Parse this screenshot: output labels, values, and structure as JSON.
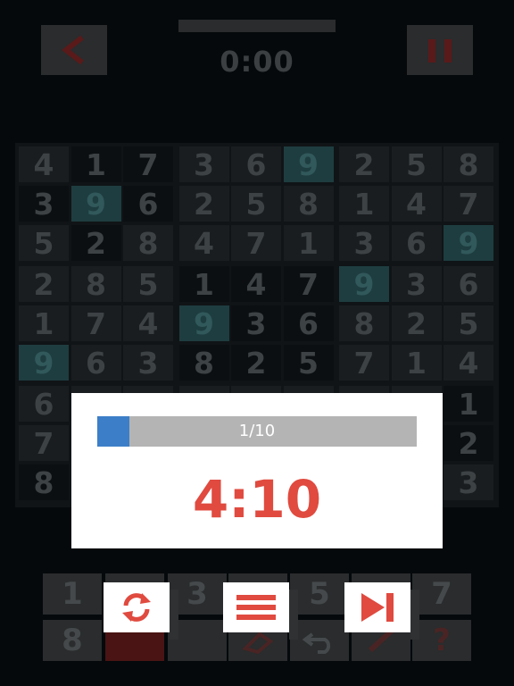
{
  "header": {
    "timer": "0:00",
    "back_icon": "chevron-left-icon",
    "pause_icon": "pause-icon"
  },
  "grid": {
    "rows": [
      [
        "4",
        "1",
        "7",
        "3",
        "6",
        "9",
        "2",
        "5",
        "8"
      ],
      [
        "3",
        "9",
        "6",
        "2",
        "5",
        "8",
        "1",
        "4",
        "7"
      ],
      [
        "5",
        "2",
        "8",
        "4",
        "7",
        "1",
        "3",
        "6",
        "9"
      ],
      [
        "2",
        "8",
        "5",
        "1",
        "4",
        "7",
        "9",
        "3",
        "6"
      ],
      [
        "1",
        "7",
        "4",
        "9",
        "3",
        "6",
        "8",
        "2",
        "5"
      ],
      [
        "9",
        "6",
        "3",
        "8",
        "2",
        "5",
        "7",
        "1",
        "4"
      ],
      [
        "6",
        "",
        "",
        "",
        "",
        "",
        "",
        "",
        "1"
      ],
      [
        "7",
        "",
        "",
        "",
        "",
        "",
        "",
        "",
        "2"
      ],
      [
        "8",
        "",
        "",
        "",
        "",
        "",
        "",
        "",
        "3"
      ]
    ],
    "highlighted_digit": "9"
  },
  "keypad": {
    "digits": [
      "1",
      "",
      "3",
      "",
      "5",
      "",
      "7"
    ],
    "row2_first": "8",
    "row2_last": "?"
  },
  "popup": {
    "progress_text": "1/10",
    "progress_fraction": 0.1,
    "time": "4:10"
  },
  "actions": {
    "restart_icon": "restart-icon",
    "menu_icon": "menu-icon",
    "next_icon": "skip-next-icon"
  },
  "colors": {
    "accent_red": "#e04a3f",
    "progress_blue": "#3c7fc8",
    "highlight_teal": "#1e3d40"
  }
}
